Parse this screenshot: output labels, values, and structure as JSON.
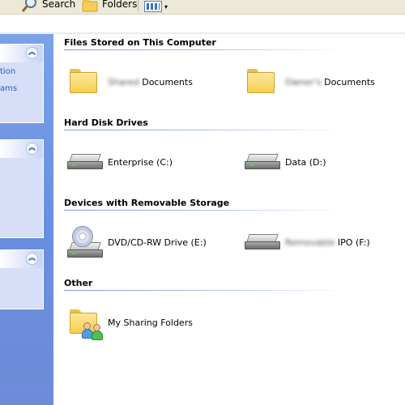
{
  "toolbar": {
    "search_label": "Search",
    "folders_label": "Folders",
    "search_icon": "search-icon",
    "folders_icon": "folders-icon",
    "views_icon": "views-icon"
  },
  "taskpane": {
    "panels": [
      {
        "links": [
          "tion",
          "ams"
        ]
      },
      {
        "links": []
      },
      {
        "links": []
      }
    ]
  },
  "groups": [
    {
      "title": "Files Stored on This Computer",
      "items": [
        {
          "name_prefix": "Shared",
          "name": "Documents",
          "icon": "folder-icon"
        },
        {
          "name_prefix": "Owner's",
          "name": "Documents",
          "icon": "folder-icon"
        }
      ]
    },
    {
      "title": "Hard Disk Drives",
      "items": [
        {
          "name": "Enterprise (C:)",
          "icon": "hard-drive-icon"
        },
        {
          "name": "Data (D:)",
          "icon": "hard-drive-icon"
        }
      ]
    },
    {
      "title": "Devices with Removable Storage",
      "items": [
        {
          "name": "DVD/CD-RW Drive (E:)",
          "icon": "dvd-drive-icon"
        },
        {
          "name_prefix": "Removable",
          "name": "IPO (F:)",
          "icon": "removable-drive-icon"
        }
      ]
    },
    {
      "title": "Other",
      "items": [
        {
          "name": "My Sharing Folders",
          "icon": "sharing-folder-icon"
        }
      ]
    }
  ],
  "colors": {
    "taskpane_blue": "#6a8fe0",
    "link_blue": "#215dc6",
    "folder_yellow": "#f4cf52",
    "toolbar_bg": "#ece9d8"
  }
}
